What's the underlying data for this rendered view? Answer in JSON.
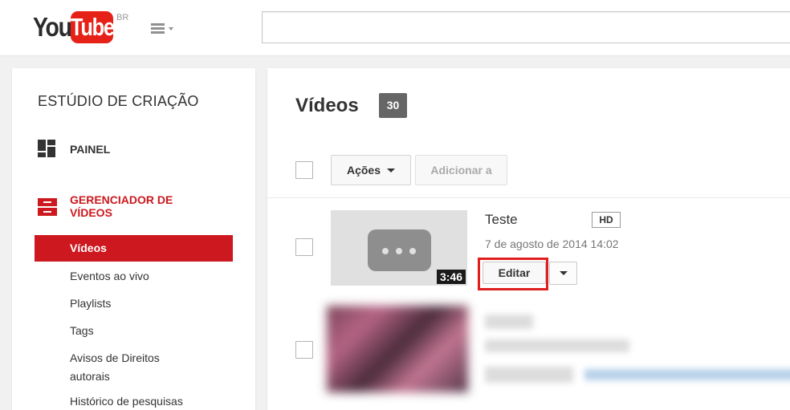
{
  "header": {
    "logo_you": "You",
    "logo_tube": "Tube",
    "logo_region": "BR",
    "search": {
      "value": "",
      "placeholder": ""
    }
  },
  "sidebar": {
    "title": "ESTÚDIO DE CRIAÇÃO",
    "dashboard_label": "PAINEL",
    "video_manager_label_line1": "GERENCIADOR DE",
    "video_manager_label_line2": "VÍDEOS",
    "items": [
      {
        "label": "Vídeos",
        "active": true
      },
      {
        "label": "Eventos ao vivo"
      },
      {
        "label": "Playlists"
      },
      {
        "label": "Tags"
      },
      {
        "label": "Avisos de Direitos autorais"
      },
      {
        "label": "Histórico de pesquisas"
      }
    ],
    "copyright_line1": "Avisos de Direitos",
    "copyright_line2": "autorais"
  },
  "main": {
    "title": "Vídeos",
    "count": "30",
    "toolbar": {
      "actions_label": "Ações",
      "add_to_label": "Adicionar a"
    },
    "videos": [
      {
        "title": "Teste",
        "quality": "HD",
        "date": "7 de agosto de 2014 14:02",
        "duration": "3:46",
        "edit_label": "Editar"
      }
    ]
  },
  "colors": {
    "brand_red": "#cc181e",
    "logo_red": "#e62117",
    "highlight": "#e01e1e"
  }
}
